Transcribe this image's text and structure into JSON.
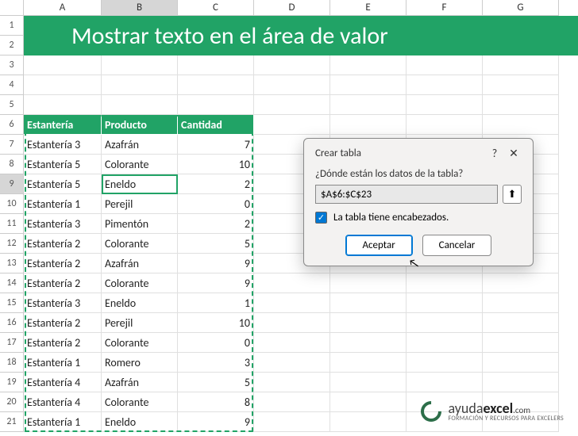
{
  "columns": [
    "A",
    "B",
    "C",
    "D",
    "E",
    "F",
    "G"
  ],
  "banner": "Mostrar texto en el área de valor",
  "headers": {
    "c0": "Estantería",
    "c1": "Producto",
    "c2": "Cantidad"
  },
  "selected_col": "B",
  "selected_row": "9",
  "rows": [
    {
      "n": "7",
      "a": "Estantería 3",
      "b": "Azafrán",
      "c": "7"
    },
    {
      "n": "8",
      "a": "Estantería 5",
      "b": "Colorante",
      "c": "10"
    },
    {
      "n": "9",
      "a": "Estantería 5",
      "b": "Eneldo",
      "c": "2"
    },
    {
      "n": "10",
      "a": "Estantería 1",
      "b": "Perejil",
      "c": "0"
    },
    {
      "n": "11",
      "a": "Estantería 3",
      "b": "Pimentón",
      "c": "2"
    },
    {
      "n": "12",
      "a": "Estantería 2",
      "b": "Colorante",
      "c": "5"
    },
    {
      "n": "13",
      "a": "Estantería 2",
      "b": "Azafrán",
      "c": "9"
    },
    {
      "n": "14",
      "a": "Estantería 2",
      "b": "Colorante",
      "c": "9"
    },
    {
      "n": "15",
      "a": "Estantería 3",
      "b": "Eneldo",
      "c": "1"
    },
    {
      "n": "16",
      "a": "Estantería 2",
      "b": "Perejil",
      "c": "10"
    },
    {
      "n": "17",
      "a": "Estantería 2",
      "b": "Colorante",
      "c": "0"
    },
    {
      "n": "18",
      "a": "Estantería 1",
      "b": "Romero",
      "c": "3"
    },
    {
      "n": "19",
      "a": "Estantería 4",
      "b": "Azafrán",
      "c": "5"
    },
    {
      "n": "20",
      "a": "Estantería 4",
      "b": "Colorante",
      "c": "8"
    },
    {
      "n": "21",
      "a": "Estantería 1",
      "b": "Eneldo",
      "c": "9"
    }
  ],
  "blank_rows": [
    "1",
    "2",
    "3",
    "4",
    "5"
  ],
  "header_row_num": "6",
  "dialog": {
    "title": "Crear tabla",
    "help_icon": "?",
    "close_icon": "✕",
    "prompt": "¿Dónde están los datos de la tabla?",
    "range": "$A$6:$C$23",
    "collapse_icon": "⬆",
    "checkbox_checked": true,
    "checkbox_label": "La tabla tiene encabezados.",
    "accept": "Aceptar",
    "cancel": "Cancelar"
  },
  "logo": {
    "main1": "ayuda",
    "main2": "excel",
    "suffix": ".com",
    "sub": "FORMACIÓN Y RECURSOS PARA EXCELERS"
  }
}
